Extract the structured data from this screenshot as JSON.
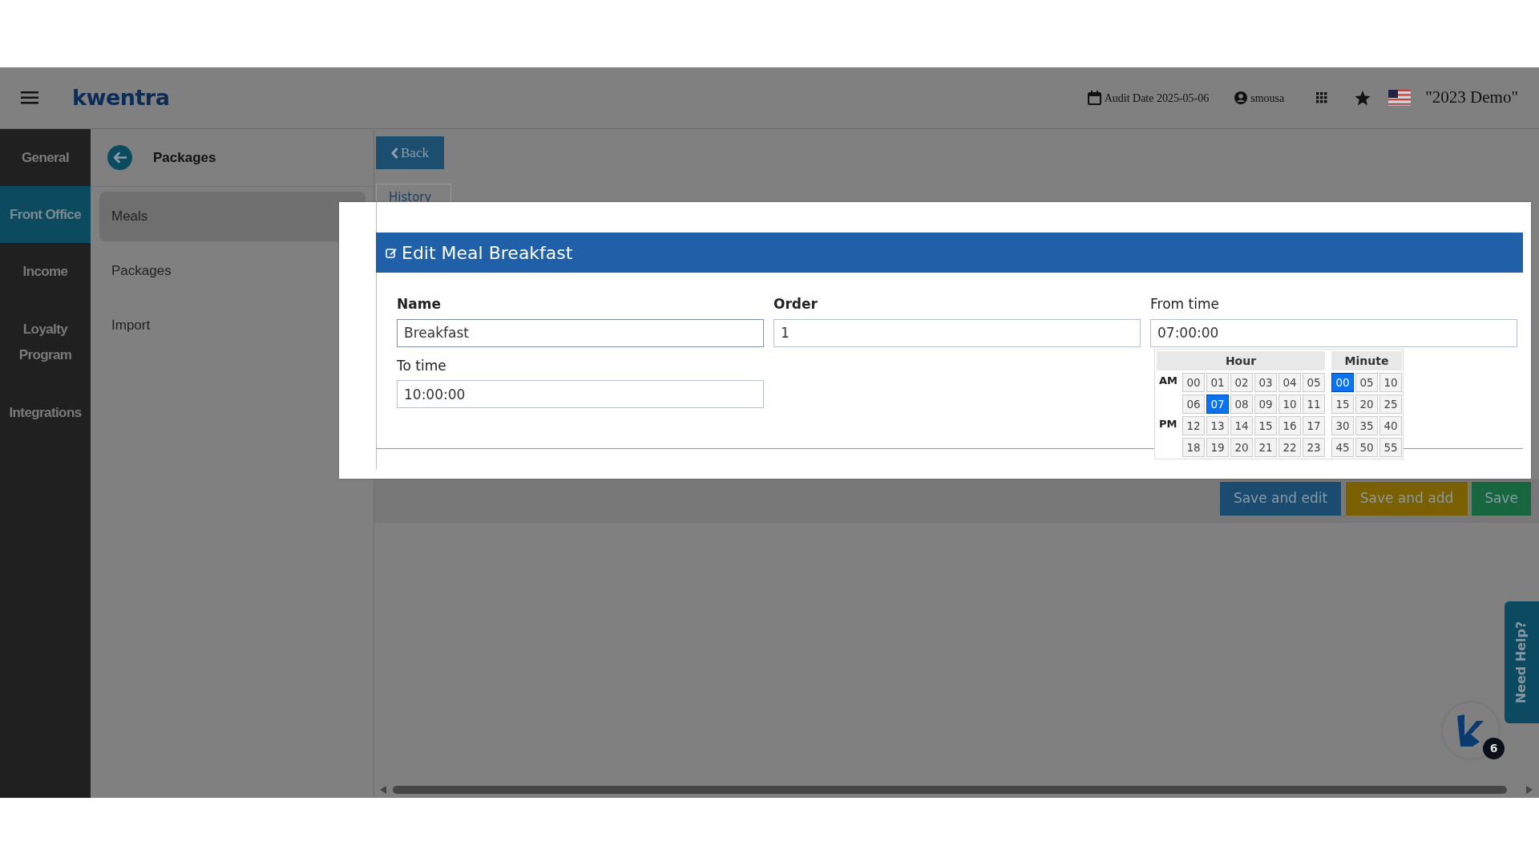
{
  "header": {
    "logo": "kwentra",
    "audit_date": "Audit Date 2025-05-06",
    "user": "smousa",
    "company": "\"2023 Demo\""
  },
  "main_nav": [
    {
      "label": "General",
      "selected": false
    },
    {
      "label": "Front Office",
      "selected": true
    },
    {
      "label": "Income",
      "selected": false
    },
    {
      "label": "Loyalty Program",
      "selected": false
    },
    {
      "label": "Integrations",
      "selected": false
    }
  ],
  "sub_nav": {
    "title": "Packages",
    "items": [
      {
        "label": "Meals",
        "selected": true
      },
      {
        "label": "Packages",
        "selected": false
      },
      {
        "label": "Import",
        "selected": false
      }
    ]
  },
  "back_button": "Back",
  "tabs": [
    {
      "label": "History"
    }
  ],
  "modal": {
    "title": "Edit Meal Breakfast",
    "fields": [
      {
        "label": "Name",
        "value": "Breakfast",
        "bold": true
      },
      {
        "label": "Order",
        "value": "1",
        "bold": true
      },
      {
        "label": "From time",
        "value": "07:00:00",
        "bold": false
      },
      {
        "label": "To time",
        "value": "10:00:00",
        "bold": false
      }
    ]
  },
  "time_picker": {
    "hour_heading": "Hour",
    "minute_heading": "Minute",
    "periods": [
      {
        "label": "AM",
        "rows": [
          [
            {
              "text": "00",
              "selected": false
            },
            {
              "text": "01",
              "selected": false
            },
            {
              "text": "02",
              "selected": false
            },
            {
              "text": "03",
              "selected": false
            },
            {
              "text": "04",
              "selected": false
            },
            {
              "text": "05",
              "selected": false
            }
          ],
          [
            {
              "text": "06",
              "selected": false
            },
            {
              "text": "07",
              "selected": true
            },
            {
              "text": "08",
              "selected": false
            },
            {
              "text": "09",
              "selected": false
            },
            {
              "text": "10",
              "selected": false
            },
            {
              "text": "11",
              "selected": false
            }
          ]
        ]
      },
      {
        "label": "PM",
        "rows": [
          [
            {
              "text": "12",
              "selected": false
            },
            {
              "text": "13",
              "selected": false
            },
            {
              "text": "14",
              "selected": false
            },
            {
              "text": "15",
              "selected": false
            },
            {
              "text": "16",
              "selected": false
            },
            {
              "text": "17",
              "selected": false
            }
          ],
          [
            {
              "text": "18",
              "selected": false
            },
            {
              "text": "19",
              "selected": false
            },
            {
              "text": "20",
              "selected": false
            },
            {
              "text": "21",
              "selected": false
            },
            {
              "text": "22",
              "selected": false
            },
            {
              "text": "23",
              "selected": false
            }
          ]
        ]
      }
    ],
    "minutes": [
      [
        {
          "text": "00",
          "selected": true
        },
        {
          "text": "05",
          "selected": false
        },
        {
          "text": "10",
          "selected": false
        }
      ],
      [
        {
          "text": "15",
          "selected": false
        },
        {
          "text": "20",
          "selected": false
        },
        {
          "text": "25",
          "selected": false
        }
      ],
      [
        {
          "text": "30",
          "selected": false
        },
        {
          "text": "35",
          "selected": false
        },
        {
          "text": "40",
          "selected": false
        }
      ],
      [
        {
          "text": "45",
          "selected": false
        },
        {
          "text": "50",
          "selected": false
        },
        {
          "text": "55",
          "selected": false
        }
      ]
    ]
  },
  "actions": [
    {
      "label": "Save and edit",
      "kind": "edit"
    },
    {
      "label": "Save and add",
      "kind": "add"
    },
    {
      "label": "Save",
      "kind": "save"
    }
  ],
  "help_tab": "Need Help?",
  "chat_badge": "6"
}
